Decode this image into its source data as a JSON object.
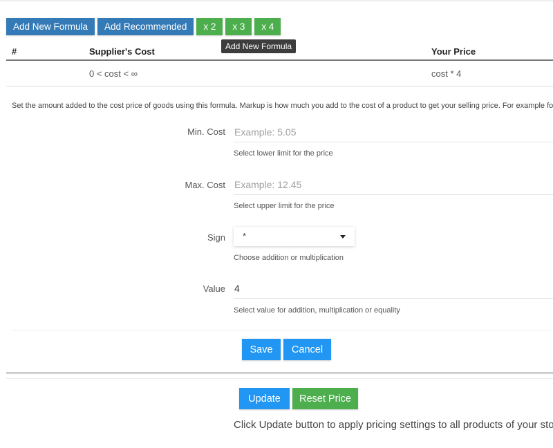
{
  "toolbar": {
    "add_new_formula": "Add New Formula",
    "add_recommended": "Add Recommended",
    "multipliers": [
      "x 2",
      "x 3",
      "x 4"
    ]
  },
  "tooltip": {
    "text": "Add New Formula"
  },
  "table": {
    "headers": {
      "index": "#",
      "suppliers_cost": "Supplier's Cost",
      "your_price": "Your Price"
    },
    "rows": [
      {
        "index": "",
        "suppliers_cost": "0 < cost < ∞",
        "your_price": "cost * 4"
      }
    ]
  },
  "description": "Set the amount added to the cost price of goods using this formula. Markup is how much you add to the cost of a product to get your selling price. For example for the item",
  "form": {
    "min_cost": {
      "label": "Min. Cost",
      "value": "",
      "placeholder": "Example: 5.05",
      "help": "Select lower limit for the price"
    },
    "max_cost": {
      "label": "Max. Cost",
      "value": "",
      "placeholder": "Example: 12.45",
      "help": "Select upper limit for the price"
    },
    "sign": {
      "label": "Sign",
      "selected": "*",
      "help": "Choose addition or multiplication"
    },
    "value": {
      "label": "Value",
      "value": "4",
      "placeholder": "",
      "help": "Select value for addition, multiplication or equality"
    },
    "save_label": "Save",
    "cancel_label": "Cancel"
  },
  "bottom": {
    "update_label": "Update",
    "reset_label": "Reset Price",
    "note": "Click Update button to apply pricing settings to all products of your store"
  },
  "colors": {
    "primary_dark": "#337ab7",
    "primary": "#2196f3",
    "success": "#4cae4c",
    "tooltip_bg": "#3d3d3d"
  }
}
